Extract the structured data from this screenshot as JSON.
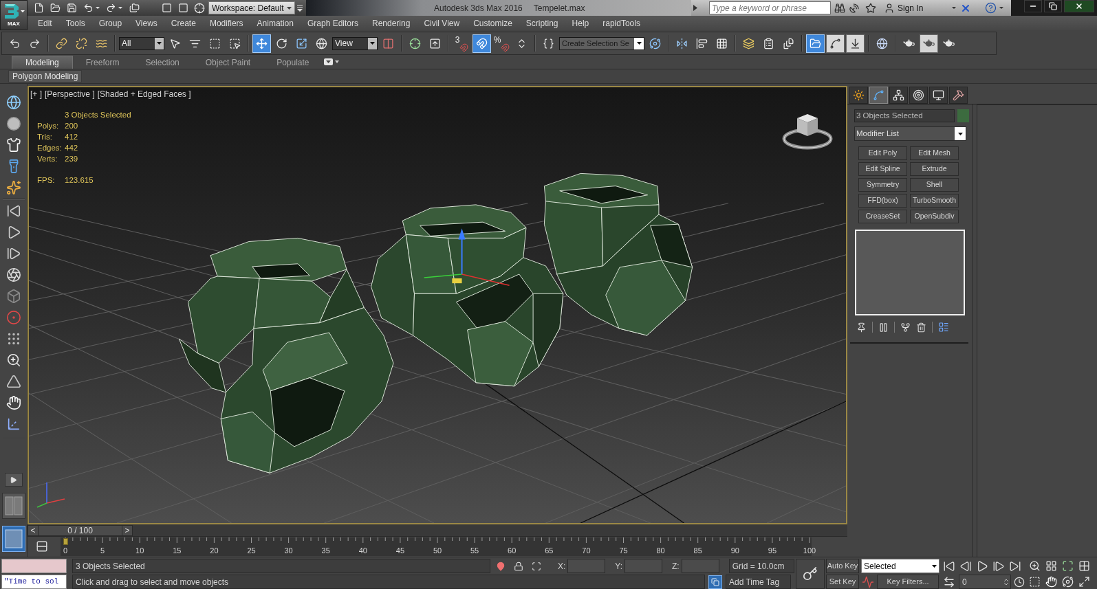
{
  "title_bar": {
    "logo_label": "MAX",
    "workspace": "Workspace: Default",
    "app_name": "Autodesk 3ds Max 2016",
    "file_name": "Tempelet.max",
    "search": {
      "placeholder": "Type a keyword or phrase"
    },
    "sign_in": "Sign In"
  },
  "menu_bar": [
    "Edit",
    "Tools",
    "Group",
    "Views",
    "Create",
    "Modifiers",
    "Animation",
    "Graph Editors",
    "Rendering",
    "Civil View",
    "Customize",
    "Scripting",
    "Help",
    "rapidTools"
  ],
  "main_toolbar": [
    {
      "kind": "undo",
      "active": false
    },
    {
      "kind": "redo",
      "active": false
    },
    {
      "kind": "link",
      "active": false
    },
    {
      "kind": "unlink",
      "active": false
    },
    {
      "kind": "bind",
      "active": false
    },
    {
      "kind": "filter",
      "value": "All"
    },
    {
      "kind": "select",
      "active": false
    },
    {
      "kind": "selectbyname",
      "active": false
    },
    {
      "kind": "region",
      "active": false
    },
    {
      "kind": "crossing",
      "active": false
    },
    {
      "kind": "move",
      "active": true
    },
    {
      "kind": "rotate",
      "active": false
    },
    {
      "kind": "scale",
      "active": false
    },
    {
      "kind": "place",
      "active": false
    },
    {
      "kind": "coordsys",
      "value": "View"
    },
    {
      "kind": "pivot",
      "active": false
    },
    {
      "kind": "manipulate",
      "active": false
    },
    {
      "kind": "override",
      "active": false
    },
    {
      "kind": "snap",
      "label": "3",
      "active": false
    },
    {
      "kind": "anglesnap",
      "active": true
    },
    {
      "kind": "percentsnap",
      "label": "%",
      "active": false
    },
    {
      "kind": "spinnersnap",
      "active": false
    },
    {
      "kind": "namedsets",
      "active": false
    },
    {
      "kind": "namedsel",
      "placeholder": "Create Selection Se"
    },
    {
      "kind": "isolate",
      "active": false
    },
    {
      "kind": "mirror",
      "active": false
    },
    {
      "kind": "align",
      "active": false
    },
    {
      "kind": "checker",
      "active": false
    },
    {
      "kind": "layers",
      "active": false
    },
    {
      "kind": "ribbon",
      "active": false
    },
    {
      "kind": "layermanager",
      "active": false
    },
    {
      "kind": "explorer",
      "active": true
    },
    {
      "kind": "curve",
      "active": false
    },
    {
      "kind": "schematic",
      "active": false
    },
    {
      "kind": "material",
      "active": false
    },
    {
      "kind": "rendersetup",
      "active": false
    },
    {
      "kind": "renderframe",
      "active": false
    },
    {
      "kind": "render",
      "active": false
    }
  ],
  "ribbon": {
    "tabs": [
      {
        "label": "Modeling",
        "selected": true
      },
      {
        "label": "Freeform",
        "selected": false
      },
      {
        "label": "Selection",
        "selected": false
      },
      {
        "label": "Object Paint",
        "selected": false
      },
      {
        "label": "Populate",
        "selected": false
      }
    ],
    "panel_label": "Polygon Modeling"
  },
  "viewport": {
    "label_parts": [
      "[+ ]",
      "[Perspective ]",
      "[Shaded + Edged Faces ]"
    ],
    "selection": "3 Objects Selected",
    "stats": [
      {
        "label": "Polys:",
        "value": "200"
      },
      {
        "label": "Tris:",
        "value": "412"
      },
      {
        "label": "Edges:",
        "value": "442"
      },
      {
        "label": "Verts:",
        "value": "239"
      }
    ],
    "fps": {
      "label": "FPS:",
      "value": "123.615"
    }
  },
  "viewport_layouts": [
    {
      "kind": "split",
      "selected": false
    },
    {
      "kind": "single",
      "selected": true
    }
  ],
  "command_panel": {
    "tabs": [
      {
        "kind": "create",
        "selected": false
      },
      {
        "kind": "modify",
        "selected": true
      },
      {
        "kind": "hierarchy",
        "selected": false
      },
      {
        "kind": "motion",
        "selected": false
      },
      {
        "kind": "display",
        "selected": false
      },
      {
        "kind": "utilities",
        "selected": false
      }
    ],
    "object_name": "3 Objects Selected",
    "modifier_list": "Modifier List",
    "modifier_buttons": [
      "Edit Poly",
      "Edit Mesh",
      "Edit Spline",
      "Extrude",
      "Symmetry",
      "Shell",
      "FFD(box)",
      "TurboSmooth",
      "CreaseSet",
      "OpenSubdiv"
    ]
  },
  "time_slider": {
    "previous": "<",
    "position": "0 / 100",
    "next": ">",
    "level": 0
  },
  "track_bar": {
    "ticks": [
      "0",
      "5",
      "10",
      "15",
      "20",
      "25",
      "30",
      "35",
      "40",
      "45",
      "50",
      "55",
      "60",
      "65",
      "70",
      "75",
      "80",
      "85",
      "90",
      "95",
      "100"
    ]
  },
  "status_bar": {
    "listener_output": "\"Time to sol",
    "selection": "3 Objects Selected",
    "prompt": "Click and drag to select and move objects",
    "coordinates": [
      "X:",
      "Y:",
      "Z:"
    ],
    "grid": "Grid = 10.0cm",
    "time_tag": "Add Time Tag",
    "auto_key": "Auto Key",
    "key_mode": "Selected",
    "set_key": "Set Key",
    "key_filters": "Key Filters...",
    "frame": "0"
  }
}
